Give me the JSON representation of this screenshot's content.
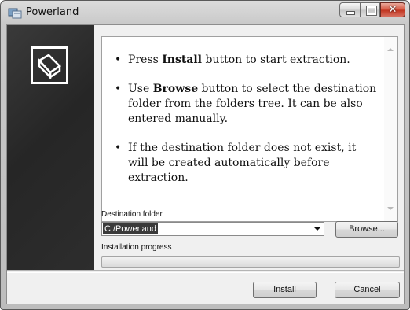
{
  "window": {
    "title": "Powerland"
  },
  "info": {
    "items": [
      {
        "before": "Press ",
        "bold": "Install",
        "after": " button to start extraction."
      },
      {
        "before": "Use ",
        "bold": "Browse",
        "after": " button to select the destination folder from the folders tree. It can be also entered manually."
      },
      {
        "before": "If the destination folder does not exist, it will be created automatically before extraction.",
        "bold": "",
        "after": ""
      }
    ]
  },
  "destination": {
    "label": "Destination folder",
    "value": "C:/Powerland",
    "browse_label": "Browse..."
  },
  "progress": {
    "label": "Installation progress",
    "value": 0
  },
  "footer": {
    "install_label": "Install",
    "cancel_label": "Cancel"
  },
  "icons": {
    "app": "setup-package-icon",
    "logo": "box-logo-icon",
    "minimize": "minimize-icon",
    "maximize": "maximize-icon",
    "close": "close-icon",
    "dropdown": "chevron-down-icon"
  },
  "colors": {
    "sidebar": "#2d2d2d",
    "close_button": "#c0321e",
    "selection": "#3a3a3a"
  }
}
